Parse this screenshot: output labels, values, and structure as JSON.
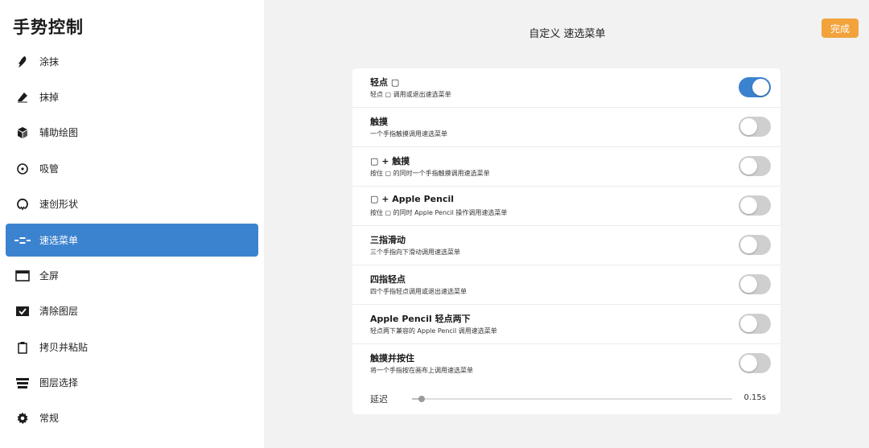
{
  "sidebar": {
    "title": "手势控制",
    "items": [
      {
        "label": "涂抹",
        "icon": "smudge-icon",
        "active": false
      },
      {
        "label": "抹掉",
        "icon": "eraser-icon",
        "active": false
      },
      {
        "label": "辅助绘图",
        "icon": "cube-icon",
        "active": false
      },
      {
        "label": "吸管",
        "icon": "eyedropper-icon",
        "active": false
      },
      {
        "label": "速创形状",
        "icon": "quickshape-icon",
        "active": false
      },
      {
        "label": "速选菜单",
        "icon": "quickmenu-icon",
        "active": true
      },
      {
        "label": "全屏",
        "icon": "fullscreen-icon",
        "active": false
      },
      {
        "label": "清除图层",
        "icon": "clear-layer-icon",
        "active": false
      },
      {
        "label": "拷贝并粘贴",
        "icon": "copy-paste-icon",
        "active": false
      },
      {
        "label": "图层选择",
        "icon": "layer-select-icon",
        "active": false
      },
      {
        "label": "常规",
        "icon": "gear-icon",
        "active": false
      }
    ]
  },
  "header": {
    "title": "自定义 速选菜单",
    "done_label": "完成"
  },
  "settings": {
    "rows": [
      {
        "title": "轻点 ▢",
        "subtitle": "轻点 ▢ 调用或退出速选菜单",
        "enabled": true
      },
      {
        "title": "触摸",
        "subtitle": "一个手指触摸调用速选菜单",
        "enabled": false
      },
      {
        "title": "▢ + 触摸",
        "subtitle": "按住 ▢ 的同时一个手指触摸调用速选菜单",
        "enabled": false
      },
      {
        "title": "▢ + Apple Pencil",
        "subtitle": "按住 ▢ 的同时 Apple Pencil 操作调用速选菜单",
        "enabled": false
      },
      {
        "title": "三指滑动",
        "subtitle": "三个手指向下滑动调用速选菜单",
        "enabled": false
      },
      {
        "title": "四指轻点",
        "subtitle": "四个手指轻点调用或退出速选菜单",
        "enabled": false
      },
      {
        "title": "Apple Pencil 轻点两下",
        "subtitle": "轻点两下兼容的 Apple Pencil 调用速选菜单",
        "enabled": false
      },
      {
        "title": "触摸并按住",
        "subtitle": "将一个手指按在画布上调用速选菜单",
        "enabled": false
      }
    ],
    "delay": {
      "label": "延迟",
      "value": "0.15s",
      "fraction": 0.03
    }
  },
  "colors": {
    "accent": "#3c83cf",
    "done_button": "#f2a33c"
  }
}
